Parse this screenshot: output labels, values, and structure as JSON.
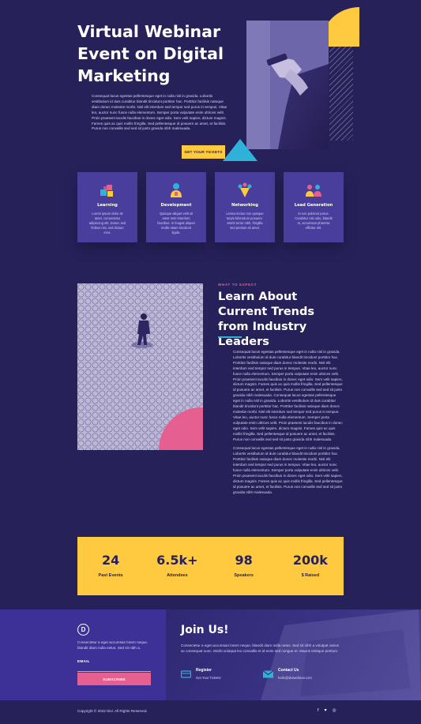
{
  "hero": {
    "title": "Virtual Webinar Event on Digital Marketing",
    "body": "Consequat lacus egestas pellentesque eget in nulla nisl in gravida. Lobortis vestibulum id duis curabitur blandit tincidunt porttitor hac. Porttitor facilisis natoque diam donec molestie morbi. Nisl elit interdum sed tempor sed purus in tempus. Vitae leo, auctor nunc fusce nulla elementum. Semper porta vulputate enim ultrices velit. Proin praesent iaculis faucibus in donec eget odio. Sem velit sapien, dictum magnis. Fames quis ac quis mollis fringilla. Sed pellentesque id posuere ac amet, et facilisis. Purus non convallis sed sed sit justo gravida nibh malesuada.",
    "cta_label": "GET YOUR TICKETS"
  },
  "features": [
    {
      "title": "Learning",
      "text": "Lorem ipsum dolor sit amet, consectetur adipiscing elit. Donec sed finibus nisi, sed dictum eros.",
      "icon": "blocks-icon"
    },
    {
      "title": "Development",
      "text": "Quisque aliquet velit sit amet sem interdum faucibus. In feugiat aliquet mollis etiam tincidunt ligula.",
      "icon": "person-icon"
    },
    {
      "title": "Networking",
      "text": "Lectus lectus non quisque turpis bibendum posuere. Morbi tortor nibh, fringilla sed pretium sit amet.",
      "icon": "network-icon"
    },
    {
      "title": "Lead Generation",
      "text": "In non pulvinar purus. Curabitur nisi odio, blandit et, accumsan pharetra efficitur elit.",
      "icon": "team-icon"
    }
  ],
  "trends": {
    "eyebrow": "WHAT TO EXPECT",
    "title": "Learn About Current Trends from Industry Leaders",
    "paragraphs": [
      "Consequat lacus egestas pellentesque eget in nulla nisl in gravida. Lobortis vestibulum id duis curabitur blandit tincidunt porttitor hac. Porttitor facilisis natoque diam donec molestie morbi. Nisl elit interdum sed tempor sed purus in tempus. Vitae leo, auctor nunc fusce nulla elementum. Semper porta vulputate enim ultrices velit. Proin praesent iaculis faucibus in donec eget odio. Sem velit sapien, dictum magnis. Fames quis ac quis mollis fringilla. Sed pellentesque id posuere ac amet, et facilisis. Purus non convallis sed sed sit justo gravida nibh malesuada. Consequat lacus egestas pellentesque eget in nulla nisl in gravida. Lobortis vestibulum id duis curabitur blandit tincidunt porttitor hac. Porttitor facilisis natoque diam donec molestie morbi. Nisl elit interdum sed tempor sed purus in tempus. Vitae leo, auctor nunc fusce nulla elementum. Semper porta vulputate enim ultrices velit. Proin praesent iaculis faucibus in donec eget odio. Sem velit sapien, dictum magnis. Fames quis ac quis mollis fringilla. Sed pellentesque id posuere ac amet, et facilisis. Purus non convallis sed sed sit justo gravida nibh malesuada.",
      "Consequat lacus egestas pellentesque eget in nulla nisl in gravida. Lobortis vestibulum id duis curabitur blandit tincidunt porttitor hac. Porttitor facilisis natoque diam donec molestie morbi. Nisl elit interdum sed tempor sed purus in tempus. Vitae leo, auctor nunc fusce nulla elementum. Semper porta vulputate enim ultrices velit. Proin praesent iaculis faucibus in donec eget odio. Sem velit sapien, dictum magnis. Fames quis ac quis mollis fringilla. Sed pellentesque id posuere ac amet, et facilisis. Purus non convallis sed sed sit justo gravida nibh malesuada."
    ]
  },
  "stats": [
    {
      "value": "24",
      "label": "Past Events"
    },
    {
      "value": "6.5k+",
      "label": "Attendees"
    },
    {
      "value": "98",
      "label": "Speakers"
    },
    {
      "value": "200k",
      "label": "$ Raised"
    }
  ],
  "footer": {
    "logo_letter": "D",
    "description": "Consectetur a eget accumsan lorem neque, blandit diam nulla netus. Sed sit nibh a.",
    "email_label": "EMAIL",
    "email_value": "",
    "subscribe_label": "SUBSCRIBE",
    "join_title": "Join Us!",
    "join_body": "Consectetur a eget accumsan lorem neque, blandit diam nulla netus. Sed sit nibh a volutpat varius ac consequat nunc. Morbi volutpat leo convallis et id enim sed congue et. Mauris tristique pretium.",
    "register_title": "Register",
    "register_sub": "Get Your Tickets!",
    "contact_title": "Contact Us",
    "contact_sub": "hello@diviwebinar.com",
    "copyright": "Copyright © 2022 Divi. All Rights Reserved."
  },
  "socials": [
    {
      "glyph": "f",
      "icon": "facebook-icon"
    },
    {
      "glyph": "♥",
      "icon": "twitter-icon"
    },
    {
      "glyph": "◎",
      "icon": "instagram-icon"
    }
  ],
  "colors": {
    "background": "#27215a",
    "accent_yellow": "#ffc940",
    "accent_pink": "#e55f90",
    "accent_cyan": "#2fb2d8",
    "card": "#4a3e9c"
  }
}
